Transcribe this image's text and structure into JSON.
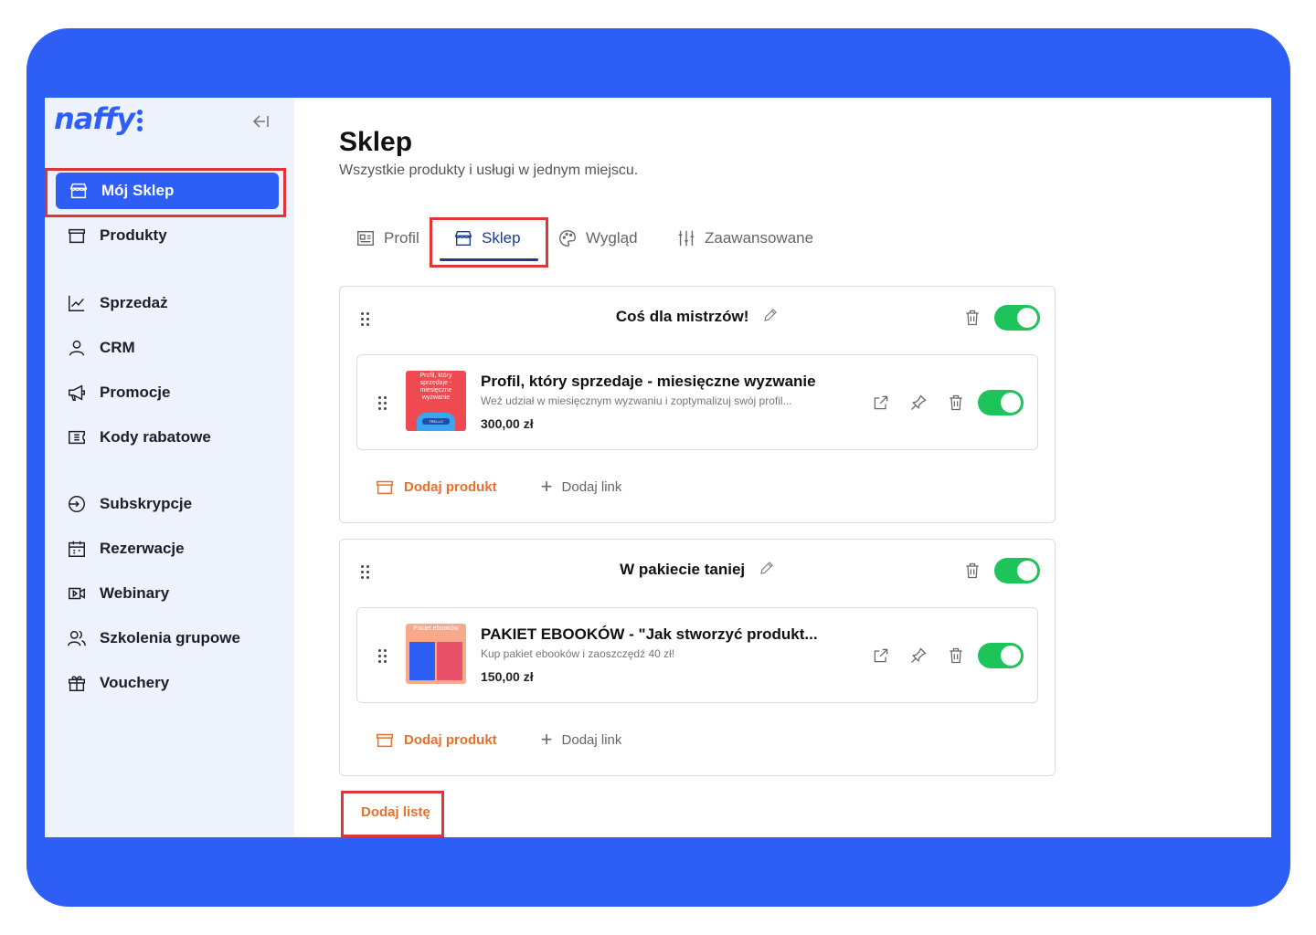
{
  "app": {
    "logo": "naffy"
  },
  "sidebar": {
    "items": [
      {
        "label": "Mój Sklep",
        "icon": "store-icon",
        "active": true
      },
      {
        "label": "Produkty",
        "icon": "box-icon"
      },
      {
        "label": "Sprzedaż",
        "icon": "chart-line-icon"
      },
      {
        "label": "CRM",
        "icon": "user-icon"
      },
      {
        "label": "Promocje",
        "icon": "megaphone-icon"
      },
      {
        "label": "Kody rabatowe",
        "icon": "ticket-icon"
      },
      {
        "label": "Subskrypcje",
        "icon": "subscription-icon"
      },
      {
        "label": "Rezerwacje",
        "icon": "calendar-icon"
      },
      {
        "label": "Webinary",
        "icon": "video-icon"
      },
      {
        "label": "Szkolenia grupowe",
        "icon": "group-icon"
      },
      {
        "label": "Vouchery",
        "icon": "gift-icon"
      }
    ]
  },
  "header": {
    "title": "Sklep",
    "subtitle": "Wszystkie produkty i usługi w jednym miejscu."
  },
  "tabs": [
    {
      "label": "Profil",
      "icon": "profile-card-icon"
    },
    {
      "label": "Sklep",
      "icon": "store-icon",
      "active": true
    },
    {
      "label": "Wygląd",
      "icon": "palette-icon"
    },
    {
      "label": "Zaawansowane",
      "icon": "sliders-icon"
    }
  ],
  "lists": [
    {
      "title": "Coś dla mistrzów!",
      "enabled": true,
      "products": [
        {
          "name": "Profil, który sprzedaje - miesięczne wyzwanie",
          "description": "Weź udział w miesięcznym wyzwaniu i zoptymalizuj swój profil...",
          "price": "300,00 zł",
          "thumb_text": "Profil, który sprzedaje - miesięczne wyzwanie",
          "thumb_badge": "TRELLO",
          "enabled": true
        }
      ],
      "add_product_label": "Dodaj produkt",
      "add_link_label": "Dodaj link"
    },
    {
      "title": "W pakiecie taniej",
      "enabled": true,
      "products": [
        {
          "name": "PAKIET EBOOKÓW - \"Jak stworzyć produkt...",
          "description": "Kup pakiet ebooków i zaoszczędź 40 zł!",
          "price": "150,00 zł",
          "thumb_text": "Pakiet ebooków",
          "enabled": true
        }
      ],
      "add_product_label": "Dodaj produkt",
      "add_link_label": "Dodaj link"
    }
  ],
  "add_list_label": "Dodaj listę",
  "colors": {
    "brand": "#2d5ef5",
    "accent_orange": "#e8702a",
    "toggle_on": "#1cc45a",
    "highlight": "#e03535"
  }
}
